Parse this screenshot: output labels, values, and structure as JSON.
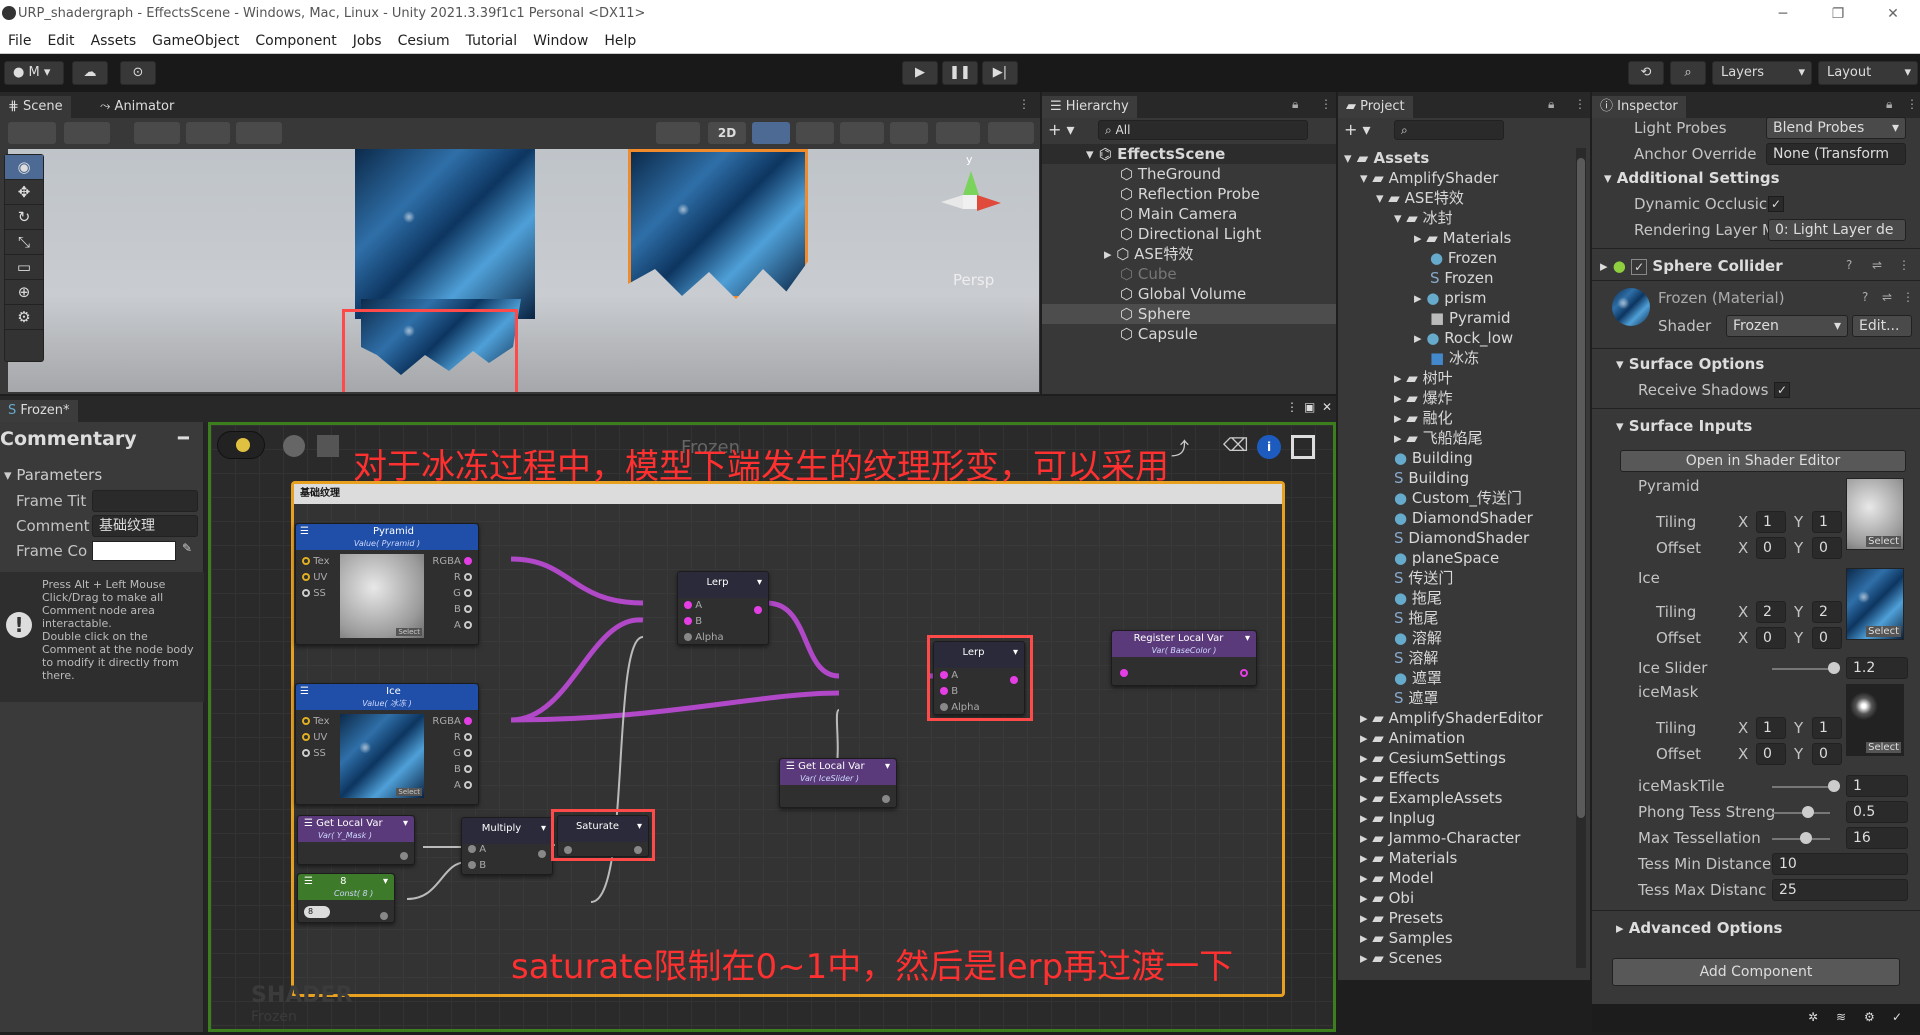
{
  "window": {
    "title": "URP_shadergraph - EffectsScene - Windows, Mac, Linux - Unity 2021.3.39f1c1 Personal <DX11>",
    "min": "─",
    "max": "❐",
    "close": "✕"
  },
  "menu": [
    "File",
    "Edit",
    "Assets",
    "GameObject",
    "Component",
    "Jobs",
    "Cesium",
    "Tutorial",
    "Window",
    "Help"
  ],
  "toolbar": {
    "account": "M",
    "layers": "Layers",
    "layout": "Layout"
  },
  "tabs": {
    "scene": "Scene",
    "animator": "Animator",
    "hierarchy": "Hierarchy",
    "project": "Project",
    "inspector": "Inspector",
    "shader": "Frozen*"
  },
  "scene": {
    "mode2d": "2D",
    "persp": "Persp",
    "gizmo_y": "y"
  },
  "hierarchy": {
    "search": "All",
    "root": "EffectsScene",
    "items": [
      "TheGround",
      "Reflection Probe",
      "Main Camera",
      "Directional Light",
      "ASE特效",
      "Cube",
      "Global Volume",
      "Sphere",
      "Capsule"
    ]
  },
  "project": {
    "assets": "Assets",
    "items": [
      "AmplifyShader",
      "ASE特效",
      "冰封",
      "Materials",
      "Frozen",
      "Frozen",
      "prism",
      "Pyramid",
      "Rock_low",
      "冰冻",
      "树叶",
      "爆炸",
      "融化",
      "飞船焰尾",
      "Building",
      "Building",
      "Custom_传送门",
      "DiamondShader",
      "DiamondShader",
      "planeSpace",
      "传送门",
      "拖尾",
      "拖尾",
      "溶解",
      "溶解",
      "遮罩",
      "遮罩",
      "AmplifyShaderEditor",
      "Animation",
      "CesiumSettings",
      "Effects",
      "ExampleAssets",
      "Inplug",
      "Jammo-Character",
      "Materials",
      "Model",
      "Obi",
      "Presets",
      "Samples",
      "Scenes"
    ]
  },
  "commentary": {
    "title": "Commentary",
    "parameters": "Parameters",
    "frame_title_label": "Frame Tit",
    "comment_label": "Comment",
    "comment_value": "基础纹理",
    "frame_color_label": "Frame Co",
    "help": "Press Alt + Left Mouse Click/Drag to make all Comment node area interactable.\nDouble click on the Comment at the node body to modify it directly from there."
  },
  "graph": {
    "frame_title": "基础纹理",
    "watermark": "SHADER",
    "watermark_sub": "Frozen",
    "bg_name": "Frozen",
    "annotation_top": "对于冰冻过程中，模型下端发生的纹理形变，可以采用",
    "annotation_bottom": "saturate限制在0~1中，然后是lerp再过渡一下",
    "nodes": {
      "pyramid": {
        "title": "Pyramid",
        "sub": "Value( Pyramid )",
        "ports_in": [
          "Tex",
          "UV",
          "SS"
        ],
        "ports_out": [
          "RGBA",
          "R",
          "G",
          "B",
          "A"
        ],
        "select": "Select"
      },
      "ice": {
        "title": "Ice",
        "sub": "Value( 冰冻 )",
        "ports_in": [
          "Tex",
          "UV",
          "SS"
        ],
        "ports_out": [
          "RGBA",
          "R",
          "G",
          "B",
          "A"
        ],
        "select": "Select"
      },
      "lerp1": {
        "title": "Lerp",
        "ports": [
          "A",
          "B",
          "Alpha"
        ]
      },
      "lerp2": {
        "title": "Lerp",
        "ports": [
          "A",
          "B",
          "Alpha"
        ]
      },
      "register": {
        "title": "Register Local Var",
        "sub": "Var( BaseColor )"
      },
      "getlocal1": {
        "title": "Get Local Var",
        "sub": "Var( IceSlider )"
      },
      "getlocal2": {
        "title": "Get Local Var",
        "sub": "Var( Y_Mask )"
      },
      "multiply": {
        "title": "Multiply",
        "ports": [
          "A",
          "B"
        ]
      },
      "saturate": {
        "title": "Saturate"
      },
      "const": {
        "title": "8",
        "sub": "Const( 8 )",
        "value": "8"
      }
    }
  },
  "inspector": {
    "light_probes": "Light Probes",
    "light_probes_val": "Blend Probes",
    "anchor": "Anchor Override",
    "anchor_val": "None (Transform",
    "additional": "Additional Settings",
    "dyn_occ": "Dynamic Occlusic",
    "render_layer": "Rendering Layer M",
    "render_layer_val": "0: Light Layer de",
    "sphere_collider": "Sphere Collider",
    "material": "Frozen (Material)",
    "shader_label": "Shader",
    "shader_val": "Frozen",
    "edit": "Edit...",
    "surface_options": "Surface Options",
    "receive_shadows": "Receive Shadows",
    "surface_inputs": "Surface Inputs",
    "open_editor": "Open in Shader Editor",
    "pyramid": "Pyramid",
    "ice": "Ice",
    "icemask": "iceMask",
    "tiling": "Tiling",
    "offset": "Offset",
    "x": "X",
    "y": "Y",
    "select": "Select",
    "pyr_tiling": [
      "1",
      "1"
    ],
    "pyr_offset": [
      "0",
      "0"
    ],
    "ice_tiling": [
      "2",
      "2"
    ],
    "ice_offset": [
      "0",
      "0"
    ],
    "mask_tiling": [
      "1",
      "1"
    ],
    "mask_offset": [
      "0",
      "0"
    ],
    "ice_slider": "Ice Slider",
    "ice_slider_val": "1.2",
    "icemask_tile": "iceMaskTile",
    "icemask_tile_val": "1",
    "phong": "Phong Tess Streng",
    "phong_val": "0.5",
    "max_tess": "Max Tessellation",
    "max_tess_val": "16",
    "tess_min": "Tess Min Distance",
    "tess_min_val": "10",
    "tess_max": "Tess Max Distanc",
    "tess_max_val": "25",
    "advanced": "Advanced Options",
    "add_component": "Add Component"
  }
}
